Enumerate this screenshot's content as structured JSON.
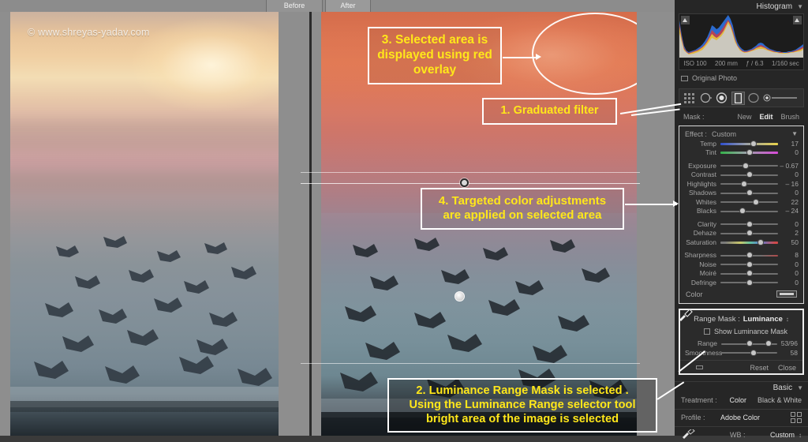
{
  "tabs": {
    "before": "Before",
    "after": "After"
  },
  "watermark": "© www.shreyas-yadav.com",
  "callouts": {
    "c1": "1. Graduated filter",
    "c2": "2. Luminance Range Mask is selected .\nUsing the Luminance Range selector tool\nbright area of the image is selected",
    "c3": "3.  Selected area is displayed using red overlay",
    "c4": "4. Targeted color adjustments are applied on selected area"
  },
  "panel": {
    "histogram": {
      "title": "Histogram",
      "chevron": "▼",
      "exif": {
        "iso": "ISO 100",
        "focal": "200 mm",
        "aperture": "ƒ / 6.3",
        "shutter": "1/160 sec"
      },
      "original_photo": "Original Photo"
    },
    "tools": [
      {
        "name": "visualize-spots-icon",
        "label": "Visualize Spots"
      },
      {
        "name": "crop-overlay-icon",
        "label": "Crop Overlay"
      },
      {
        "name": "spot-removal-icon",
        "label": "Spot Removal"
      },
      {
        "name": "graduated-filter-icon",
        "label": "Graduated Filter",
        "selected": true
      },
      {
        "name": "radial-filter-icon",
        "label": "Radial Filter"
      },
      {
        "name": "adjustment-brush-icon",
        "label": "Adjustment Brush"
      }
    ],
    "mask": {
      "label": "Mask :",
      "new": "New",
      "edit": "Edit",
      "brush": "Brush",
      "active": "Edit"
    },
    "effect": {
      "label": "Effect :",
      "value": "Custom",
      "chevron": "▼"
    },
    "sliders": [
      {
        "name": "Temp",
        "value": "17",
        "pos": 58,
        "style": "grad-temp"
      },
      {
        "name": "Tint",
        "value": "0",
        "pos": 50,
        "style": "grad-tint"
      },
      {
        "name": "Exposure",
        "value": "– 0.67",
        "pos": 44,
        "style": ""
      },
      {
        "name": "Contrast",
        "value": "0",
        "pos": 50,
        "style": ""
      },
      {
        "name": "Highlights",
        "value": "– 16",
        "pos": 41,
        "style": ""
      },
      {
        "name": "Shadows",
        "value": "0",
        "pos": 50,
        "style": ""
      },
      {
        "name": "Whites",
        "value": "22",
        "pos": 61,
        "style": ""
      },
      {
        "name": "Blacks",
        "value": "– 24",
        "pos": 38,
        "style": ""
      },
      {
        "name": "Clarity",
        "value": "0",
        "pos": 50,
        "style": ""
      },
      {
        "name": "Dehaze",
        "value": "2",
        "pos": 50,
        "style": ""
      },
      {
        "name": "Saturation",
        "value": "50",
        "pos": 70,
        "style": "grad-sat"
      },
      {
        "name": "Sharpness",
        "value": "8",
        "pos": 50,
        "style": "grad-sharp"
      },
      {
        "name": "Noise",
        "value": "0",
        "pos": 50,
        "style": ""
      },
      {
        "name": "Moiré",
        "value": "0",
        "pos": 50,
        "style": ""
      },
      {
        "name": "Defringe",
        "value": "0",
        "pos": 50,
        "style": ""
      }
    ],
    "color": {
      "label": "Color"
    },
    "range_mask": {
      "label": "Range Mask :",
      "mode": "Luminance",
      "chevron": "↕",
      "show_mask": "Show Luminance Mask",
      "range_label": "Range",
      "range_value": "53/96",
      "smoothness_label": "Smoothness",
      "smoothness_value": "58",
      "reset": "Reset",
      "close": "Close"
    },
    "basic": {
      "title": "Basic",
      "chevron": "▼",
      "treatment_label": "Treatment :",
      "treatment_color": "Color",
      "treatment_bw": "Black & White",
      "profile_label": "Profile :",
      "profile_value": "Adobe Color",
      "wb_label": "WB :",
      "wb_value": "Custom"
    }
  },
  "chart_data": {
    "type": "area",
    "title": "Histogram",
    "series": [
      {
        "name": "red",
        "values": [
          22,
          8,
          4,
          3,
          3,
          4,
          5,
          6,
          7,
          9,
          12,
          16,
          22,
          30,
          44,
          58,
          52,
          46,
          50,
          56,
          62,
          70,
          78,
          70,
          58,
          40,
          28,
          20,
          16,
          14,
          14,
          16,
          20,
          26,
          34,
          44,
          50,
          46,
          38,
          30,
          24,
          18,
          14,
          12,
          10,
          9,
          8,
          8,
          9,
          10,
          12,
          15,
          20
        ]
      },
      {
        "name": "green",
        "values": [
          20,
          7,
          3,
          3,
          3,
          3,
          4,
          5,
          6,
          7,
          9,
          12,
          17,
          24,
          36,
          48,
          44,
          40,
          44,
          52,
          60,
          72,
          86,
          74,
          56,
          34,
          22,
          15,
          12,
          10,
          10,
          11,
          13,
          16,
          20,
          25,
          28,
          26,
          21,
          17,
          13,
          10,
          8,
          7,
          6,
          6,
          6,
          6,
          7,
          8,
          9,
          11,
          14
        ]
      },
      {
        "name": "blue",
        "values": [
          24,
          9,
          4,
          3,
          3,
          4,
          4,
          5,
          6,
          8,
          10,
          14,
          20,
          30,
          52,
          76,
          80,
          78,
          82,
          90,
          95,
          98,
          96,
          80,
          58,
          32,
          19,
          13,
          10,
          8,
          8,
          9,
          10,
          12,
          15,
          18,
          20,
          18,
          15,
          12,
          10,
          8,
          7,
          6,
          6,
          5,
          5,
          5,
          6,
          7,
          8,
          10,
          13
        ]
      }
    ],
    "xlabel": "",
    "ylabel": "",
    "grid": false,
    "legend": false
  }
}
